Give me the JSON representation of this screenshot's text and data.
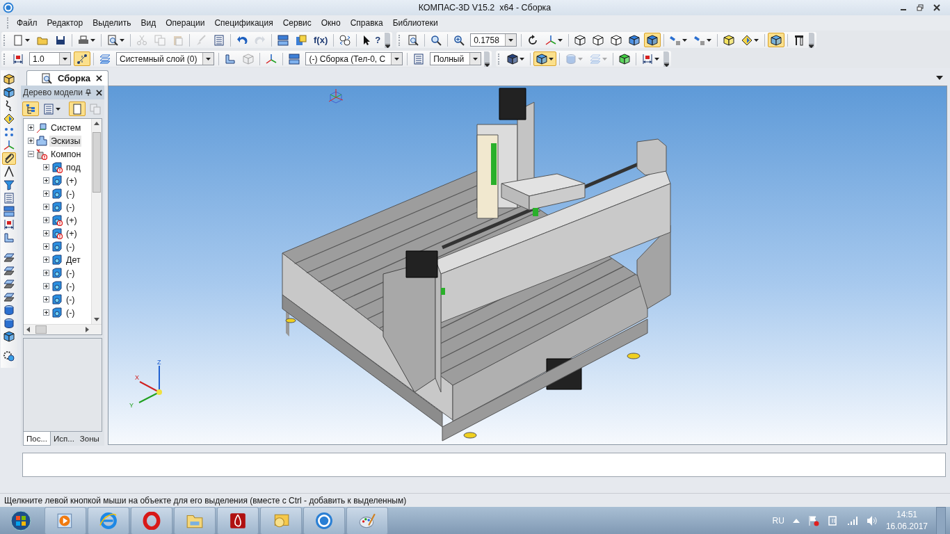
{
  "window": {
    "title": "КОМПАС-3D V15.2  x64 - Сборка"
  },
  "menu": [
    "Файл",
    "Редактор",
    "Выделить",
    "Вид",
    "Операции",
    "Спецификация",
    "Сервис",
    "Окно",
    "Справка",
    "Библиотеки"
  ],
  "toolbar_rows": [
    [
      {
        "items": [
          {
            "kind": "split",
            "on": false,
            "disabled": false
          },
          {
            "kind": "button",
            "on": false,
            "disabled": false
          },
          {
            "kind": "button",
            "on": false,
            "disabled": false
          },
          {
            "kind": "sep"
          },
          {
            "kind": "split",
            "on": false,
            "disabled": false
          },
          {
            "kind": "sep"
          },
          {
            "kind": "split",
            "on": false,
            "disabled": false
          },
          {
            "kind": "sep"
          },
          {
            "kind": "button",
            "on": false,
            "disabled": true
          },
          {
            "kind": "button",
            "on": false,
            "disabled": true
          },
          {
            "kind": "button",
            "on": false,
            "disabled": true
          },
          {
            "kind": "sep"
          },
          {
            "kind": "button",
            "on": false,
            "disabled": true
          },
          {
            "kind": "button",
            "on": false,
            "disabled": false
          },
          {
            "kind": "sep"
          },
          {
            "kind": "button",
            "on": false,
            "disabled": false
          },
          {
            "kind": "button",
            "on": false,
            "disabled": true
          },
          {
            "kind": "sep"
          },
          {
            "kind": "button",
            "on": false,
            "disabled": false
          },
          {
            "kind": "button",
            "on": false,
            "disabled": false
          },
          {
            "kind": "button",
            "on": false,
            "disabled": false,
            "label": "f(x)"
          },
          {
            "kind": "sep"
          },
          {
            "kind": "button",
            "on": false,
            "disabled": false
          },
          {
            "kind": "sep"
          },
          {
            "kind": "button",
            "on": false,
            "disabled": false,
            "label": "?"
          }
        ]
      },
      {
        "items": [
          {
            "kind": "button",
            "on": false,
            "disabled": false
          },
          {
            "kind": "sep"
          },
          {
            "kind": "button",
            "on": false,
            "disabled": false
          },
          {
            "kind": "sep"
          },
          {
            "kind": "button",
            "on": false,
            "disabled": false
          },
          {
            "kind": "combo",
            "value": "0.1758"
          },
          {
            "kind": "sep"
          },
          {
            "kind": "button",
            "on": false,
            "disabled": false
          },
          {
            "kind": "split",
            "on": false,
            "disabled": false
          },
          {
            "kind": "sep"
          },
          {
            "kind": "button",
            "on": false,
            "disabled": false
          },
          {
            "kind": "button",
            "on": false,
            "disabled": false
          },
          {
            "kind": "button",
            "on": false,
            "disabled": false
          },
          {
            "kind": "button",
            "on": false,
            "disabled": false
          },
          {
            "kind": "button",
            "on": true,
            "disabled": false
          },
          {
            "kind": "sep"
          },
          {
            "kind": "split",
            "on": false,
            "disabled": false
          },
          {
            "kind": "split",
            "on": false,
            "disabled": false
          },
          {
            "kind": "sep"
          },
          {
            "kind": "button",
            "on": false,
            "disabled": false
          },
          {
            "kind": "split",
            "on": false,
            "disabled": false
          },
          {
            "kind": "sep"
          },
          {
            "kind": "button",
            "on": true,
            "disabled": false
          },
          {
            "kind": "sep"
          },
          {
            "kind": "button",
            "on": false,
            "disabled": false
          }
        ]
      }
    ],
    [
      {
        "items": [
          {
            "kind": "button",
            "on": false,
            "disabled": false
          },
          {
            "kind": "combo",
            "value": "1.0"
          },
          {
            "kind": "button",
            "on": true,
            "disabled": false
          },
          {
            "kind": "sep"
          },
          {
            "kind": "button",
            "on": false,
            "disabled": false
          },
          {
            "kind": "combo",
            "value": "Системный слой (0)"
          },
          {
            "kind": "sep"
          },
          {
            "kind": "button",
            "on": false,
            "disabled": false
          },
          {
            "kind": "button",
            "on": false,
            "disabled": true
          },
          {
            "kind": "sep"
          },
          {
            "kind": "button",
            "on": false,
            "disabled": false
          },
          {
            "kind": "sep"
          },
          {
            "kind": "button",
            "on": false,
            "disabled": false
          },
          {
            "kind": "combo",
            "value": "(-) Сборка (Тел-0, С"
          },
          {
            "kind": "sep"
          },
          {
            "kind": "button",
            "on": false,
            "disabled": false
          },
          {
            "kind": "combo",
            "value": "Полный"
          }
        ]
      },
      {
        "items": [
          {
            "kind": "split",
            "on": false,
            "disabled": false
          },
          {
            "kind": "sep"
          },
          {
            "kind": "split",
            "on": true,
            "disabled": false
          },
          {
            "kind": "sep"
          },
          {
            "kind": "split",
            "on": false,
            "disabled": true
          },
          {
            "kind": "split",
            "on": false,
            "disabled": true
          },
          {
            "kind": "sep"
          },
          {
            "kind": "button",
            "on": false,
            "disabled": false
          },
          {
            "kind": "sep"
          },
          {
            "kind": "split",
            "on": false,
            "disabled": false
          }
        ]
      }
    ]
  ],
  "left_toolbar": [
    {
      "kind": "button",
      "on": false,
      "disabled": false
    },
    {
      "kind": "button",
      "on": false,
      "disabled": false
    },
    {
      "kind": "button",
      "on": false,
      "disabled": false
    },
    {
      "kind": "button",
      "on": false,
      "disabled": false
    },
    {
      "kind": "button",
      "on": false,
      "disabled": false
    },
    {
      "kind": "button",
      "on": false,
      "disabled": false
    },
    {
      "kind": "button",
      "on": true,
      "disabled": false
    },
    {
      "kind": "button",
      "on": false,
      "disabled": false
    },
    {
      "kind": "button",
      "on": false,
      "disabled": false
    },
    {
      "kind": "button",
      "on": false,
      "disabled": false
    },
    {
      "kind": "button",
      "on": false,
      "disabled": false
    },
    {
      "kind": "button",
      "on": false,
      "disabled": false
    },
    {
      "kind": "button",
      "on": false,
      "disabled": false
    },
    {
      "kind": "sep"
    },
    {
      "kind": "button",
      "on": false,
      "disabled": false
    },
    {
      "kind": "button",
      "on": false,
      "disabled": false
    },
    {
      "kind": "button",
      "on": false,
      "disabled": false
    },
    {
      "kind": "button",
      "on": false,
      "disabled": false
    },
    {
      "kind": "button",
      "on": false,
      "disabled": false
    },
    {
      "kind": "button",
      "on": false,
      "disabled": false
    },
    {
      "kind": "button",
      "on": false,
      "disabled": false
    },
    {
      "kind": "sep"
    },
    {
      "kind": "button",
      "on": false,
      "disabled": false
    }
  ],
  "document_tab": {
    "label": "Сборка",
    "selected": true
  },
  "model_tree": {
    "title": "Дерево модели",
    "toolbar": [
      {
        "kind": "button",
        "on": true,
        "disabled": false
      },
      {
        "kind": "split",
        "on": false,
        "disabled": false
      },
      {
        "kind": "sep"
      },
      {
        "kind": "button",
        "on": true,
        "disabled": false
      },
      {
        "kind": "button",
        "on": false,
        "disabled": true
      }
    ],
    "items": [
      {
        "label": "Систем",
        "kind": "coordinate-system",
        "expanded": false,
        "selected": false,
        "warning": false
      },
      {
        "label": "Эскизы",
        "kind": "sketches",
        "expanded": false,
        "selected": true,
        "warning": false
      },
      {
        "label": "Компон",
        "kind": "components",
        "expanded": true,
        "selected": false,
        "warning": true,
        "children": [
          {
            "label": "под",
            "kind": "part",
            "expanded": false,
            "selected": false,
            "warning": true
          },
          {
            "label": "(+)",
            "kind": "part",
            "expanded": false,
            "selected": false,
            "warning": false
          },
          {
            "label": "(-)",
            "kind": "part",
            "expanded": false,
            "selected": false,
            "warning": false
          },
          {
            "label": "(-)",
            "kind": "part",
            "expanded": false,
            "selected": false,
            "warning": false
          },
          {
            "label": "(+)",
            "kind": "part",
            "expanded": false,
            "selected": false,
            "warning": true
          },
          {
            "label": "(+)",
            "kind": "part",
            "expanded": false,
            "selected": false,
            "warning": true
          },
          {
            "label": "(-)",
            "kind": "part",
            "expanded": false,
            "selected": false,
            "warning": false
          },
          {
            "label": "Дет",
            "kind": "part",
            "expanded": false,
            "selected": false,
            "warning": false
          },
          {
            "label": "(-)",
            "kind": "part",
            "expanded": false,
            "selected": false,
            "warning": false
          },
          {
            "label": "(-)",
            "kind": "part",
            "expanded": false,
            "selected": false,
            "warning": false
          },
          {
            "label": "(-)",
            "kind": "part",
            "expanded": false,
            "selected": false,
            "warning": false
          },
          {
            "label": "(-)",
            "kind": "part",
            "expanded": false,
            "selected": false,
            "warning": false
          }
        ]
      }
    ],
    "tabs": [
      {
        "label": "Пос...",
        "selected": true
      },
      {
        "label": "Исп...",
        "selected": false
      },
      {
        "label": "Зоны",
        "selected": false
      }
    ]
  },
  "viewport": {
    "axis_labels": {
      "z": "Z",
      "x": "X",
      "y": "Y"
    }
  },
  "status_bar": {
    "message": "Щелкните левой кнопкой мыши на объекте для его выделения (вместе с Ctrl - добавить к выделенным)"
  },
  "taskbar": {
    "language": "RU",
    "time": "14:51",
    "date": "16.06.2017"
  }
}
